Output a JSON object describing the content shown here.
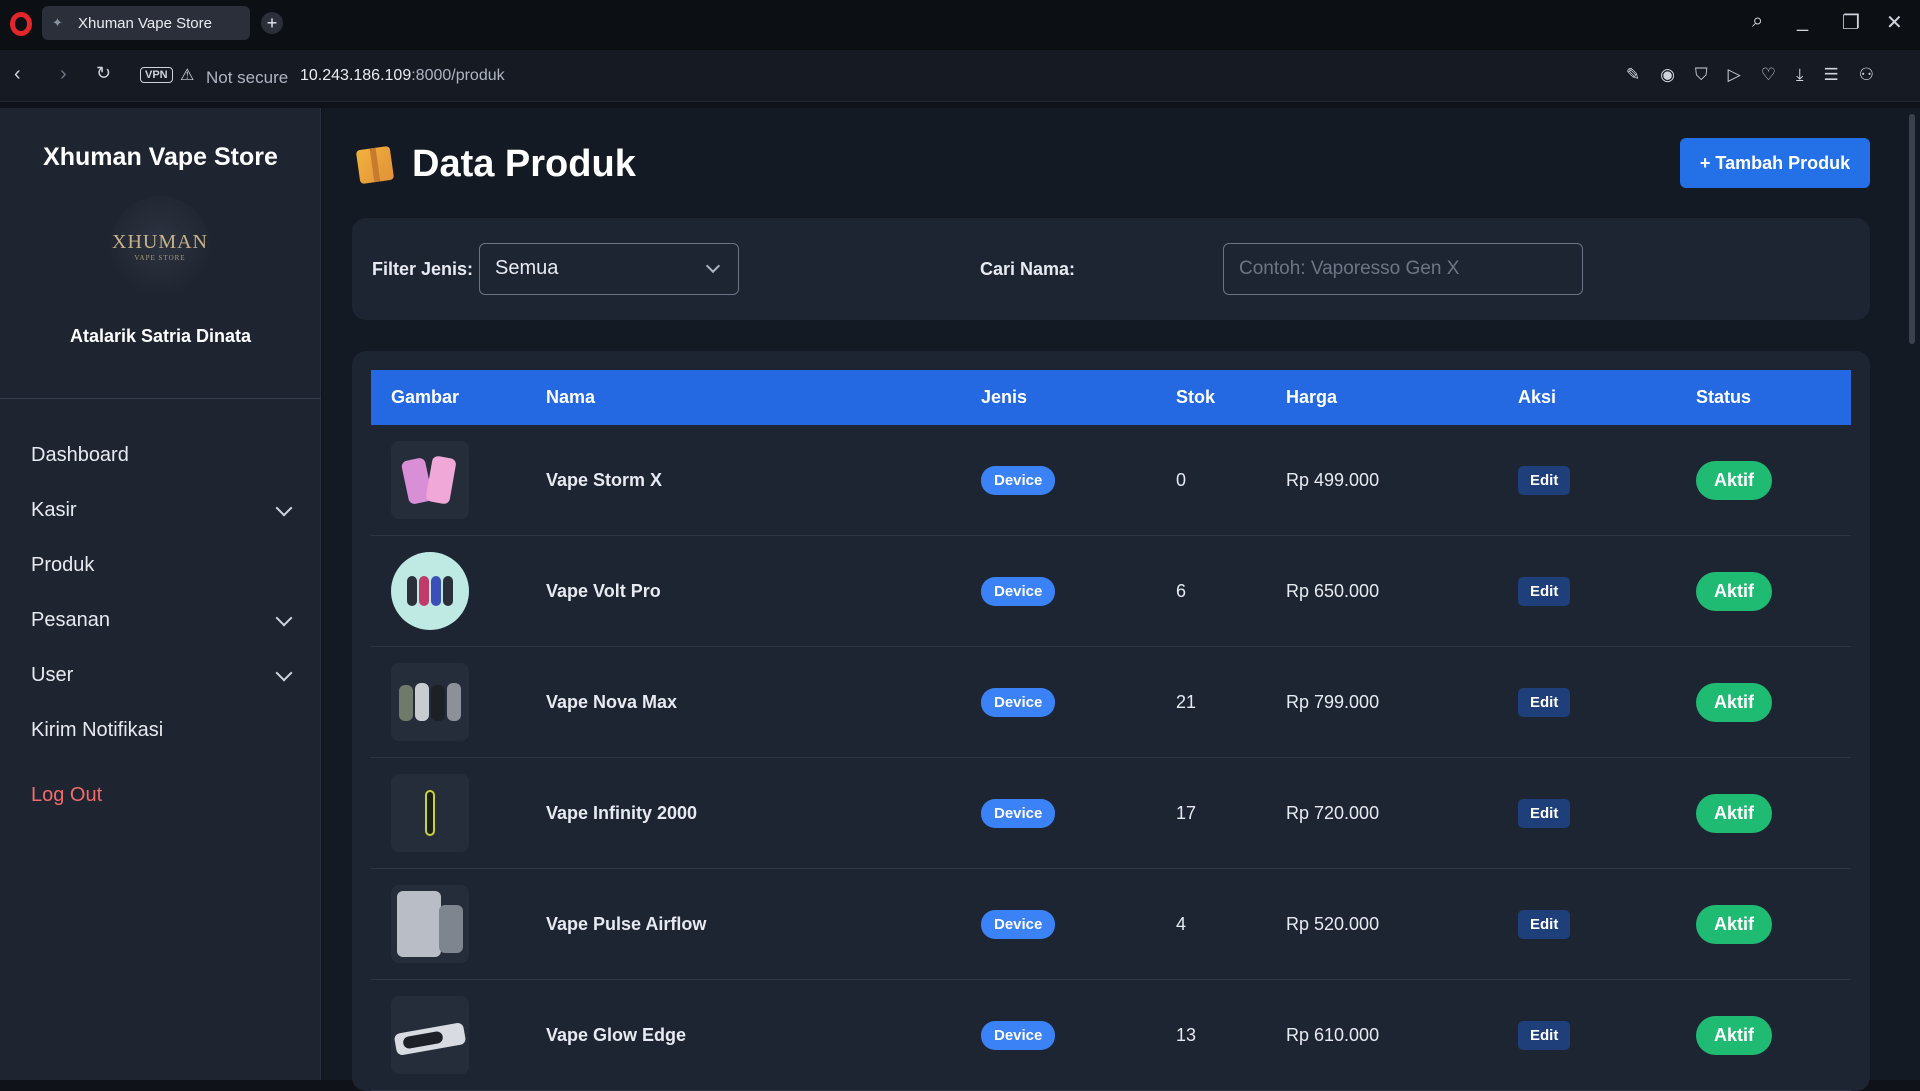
{
  "browser": {
    "tab_title": "Xhuman Vape Store",
    "new_tab": "+",
    "vpn_label": "VPN",
    "security_text": "Not secure",
    "url_host": "10.243.186.109",
    "url_path": ":8000/produk",
    "controls": [
      "search-icon",
      "minimize-icon",
      "restore-icon",
      "close-icon"
    ],
    "toolbar_icons": [
      "edit-icon",
      "camera-icon",
      "shield-icon",
      "play-icon",
      "heart-icon",
      "download-icon",
      "menu-icon",
      "profile-icon"
    ]
  },
  "sidebar": {
    "brand": "Xhuman Vape Store",
    "logo_text": "XHUMAN",
    "logo_subtext": "VAPE STORE",
    "owner": "Atalarik Satria Dinata",
    "items": [
      {
        "label": "Dashboard",
        "has_submenu": false
      },
      {
        "label": "Kasir",
        "has_submenu": true
      },
      {
        "label": "Produk",
        "has_submenu": false
      },
      {
        "label": "Pesanan",
        "has_submenu": true
      },
      {
        "label": "User",
        "has_submenu": true
      },
      {
        "label": "Kirim Notifikasi",
        "has_submenu": false
      }
    ],
    "logout": "Log Out"
  },
  "main": {
    "title": "Data Produk",
    "add_button": "+ Tambah Produk",
    "filter": {
      "jenis_label": "Filter Jenis:",
      "jenis_value": "Semua",
      "nama_label": "Cari Nama:",
      "nama_placeholder": "Contoh: Vaporesso Gen X"
    },
    "table": {
      "headers": [
        "Gambar",
        "Nama",
        "Jenis",
        "Stok",
        "Harga",
        "Aksi",
        "Status"
      ],
      "rows": [
        {
          "nama": "Vape Storm X",
          "jenis": "Device",
          "stok": "0",
          "harga": "Rp 499.000",
          "aksi": "Edit",
          "status": "Aktif"
        },
        {
          "nama": "Vape Volt Pro",
          "jenis": "Device",
          "stok": "6",
          "harga": "Rp 650.000",
          "aksi": "Edit",
          "status": "Aktif"
        },
        {
          "nama": "Vape Nova Max",
          "jenis": "Device",
          "stok": "21",
          "harga": "Rp 799.000",
          "aksi": "Edit",
          "status": "Aktif"
        },
        {
          "nama": "Vape Infinity 2000",
          "jenis": "Device",
          "stok": "17",
          "harga": "Rp 720.000",
          "aksi": "Edit",
          "status": "Aktif"
        },
        {
          "nama": "Vape Pulse Airflow",
          "jenis": "Device",
          "stok": "4",
          "harga": "Rp 520.000",
          "aksi": "Edit",
          "status": "Aktif"
        },
        {
          "nama": "Vape Glow Edge",
          "jenis": "Device",
          "stok": "13",
          "harga": "Rp 610.000",
          "aksi": "Edit",
          "status": "Aktif"
        }
      ]
    }
  },
  "colors": {
    "accent": "#2470e6",
    "header_blue": "#2469e2",
    "status_green": "#1fbb73",
    "logout_red": "#f36b6b"
  }
}
